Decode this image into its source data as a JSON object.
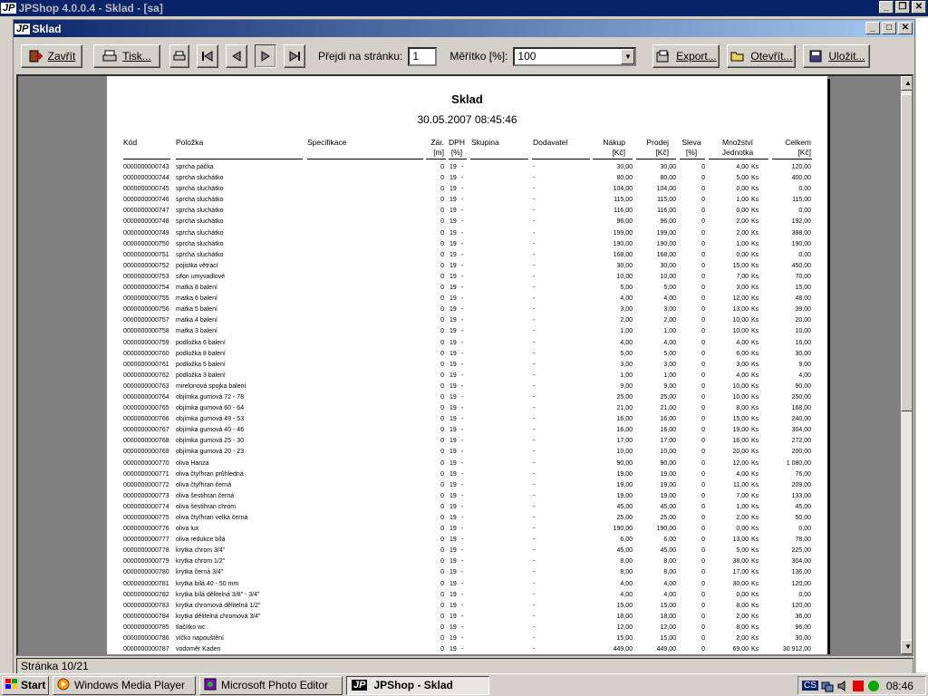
{
  "outer_window": {
    "title": "JPShop 4.0.0.4 - Sklad - [sa]",
    "logo": "JP"
  },
  "inner_window": {
    "title": "Sklad",
    "logo": "JP"
  },
  "toolbar": {
    "close_label": "Zavřít",
    "print_label": "Tisk...",
    "goto_label": "Přejdi na stránku:",
    "goto_value": "1",
    "scale_label": "Měřítko [%]:",
    "scale_value": "100",
    "export_label": "Export...",
    "open_label": "Otevřít...",
    "save_label": "Uložit..."
  },
  "report": {
    "title": "Sklad",
    "datetime": "30.05.2007 08:45:46",
    "columns": {
      "kod": "Kód",
      "polozka": "Položka",
      "specifikace": "Specifikace",
      "zar1": "Zár.",
      "zar2": "[m]",
      "dph1": "DPH",
      "dph2": "[%]",
      "skupina": "Skupina",
      "dodavatel": "Dodavatel",
      "nakup1": "Nákup",
      "nakup2": "[Kč]",
      "prodej1": "Prodej",
      "prodej2": "[Kč]",
      "sleva1": "Sleva",
      "sleva2": "[%]",
      "mnozstvi1": "Množství",
      "mnozstvi2": "Jednotka",
      "celkem1": "Celkem",
      "celkem2": "[Kč]"
    },
    "rows": [
      [
        "0000000000743",
        "sprcha páčka",
        "0",
        "19",
        "-",
        "-",
        "30,00",
        "30,00",
        "0",
        "4,00",
        "Ks",
        "120,00"
      ],
      [
        "0000000000744",
        "sprcha sluchátko",
        "0",
        "19",
        "-",
        "-",
        "80,00",
        "80,00",
        "0",
        "5,00",
        "Ks",
        "400,00"
      ],
      [
        "0000000000745",
        "sprcha sluchátko",
        "0",
        "19",
        "-",
        "-",
        "104,00",
        "104,00",
        "0",
        "0,00",
        "Ks",
        "0,00"
      ],
      [
        "0000000000746",
        "sprcha sluchátko",
        "0",
        "19",
        "-",
        "-",
        "115,00",
        "115,00",
        "0",
        "1,00",
        "Ks",
        "115,00"
      ],
      [
        "0000000000747",
        "sprcha sluchátko",
        "0",
        "19",
        "-",
        "-",
        "116,00",
        "116,00",
        "0",
        "0,00",
        "Ks",
        "0,00"
      ],
      [
        "0000000000748",
        "sprcha sluchátko",
        "0",
        "19",
        "-",
        "-",
        "96,00",
        "96,00",
        "0",
        "2,00",
        "Ks",
        "192,00"
      ],
      [
        "0000000000749",
        "sprcha sluchátko",
        "0",
        "19",
        "-",
        "-",
        "199,00",
        "199,00",
        "0",
        "2,00",
        "Ks",
        "398,00"
      ],
      [
        "0000000000750",
        "sprcha sluchátko",
        "0",
        "19",
        "-",
        "-",
        "190,00",
        "190,00",
        "0",
        "1,00",
        "Ks",
        "190,00"
      ],
      [
        "0000000000751",
        "sprcha sluchátko",
        "0",
        "19",
        "-",
        "-",
        "168,00",
        "168,00",
        "0",
        "0,00",
        "Ks",
        "0,00"
      ],
      [
        "0000000000752",
        "pojistka větrací",
        "0",
        "19",
        "-",
        "-",
        "30,00",
        "30,00",
        "0",
        "15,00",
        "Ks",
        "450,00"
      ],
      [
        "0000000000753",
        "sifon umyvadlové",
        "0",
        "19",
        "-",
        "-",
        "10,00",
        "10,00",
        "0",
        "7,00",
        "Ks",
        "70,00"
      ],
      [
        "0000000000754",
        "matka 8 balení",
        "0",
        "19",
        "-",
        "-",
        "5,00",
        "5,00",
        "0",
        "3,00",
        "Ks",
        "15,00"
      ],
      [
        "0000000000755",
        "matka 6 balení",
        "0",
        "19",
        "-",
        "-",
        "4,00",
        "4,00",
        "0",
        "12,00",
        "Ks",
        "48,00"
      ],
      [
        "0000000000756",
        "matka 5 balení",
        "0",
        "19",
        "-",
        "-",
        "3,00",
        "3,00",
        "0",
        "13,00",
        "Ks",
        "39,00"
      ],
      [
        "0000000000757",
        "matka 4 balení",
        "0",
        "19",
        "-",
        "-",
        "2,00",
        "2,00",
        "0",
        "10,00",
        "Ks",
        "20,00"
      ],
      [
        "0000000000758",
        "matka 3 balení",
        "0",
        "19",
        "-",
        "-",
        "1,00",
        "1,00",
        "0",
        "10,00",
        "Ks",
        "10,00"
      ],
      [
        "0000000000759",
        "podložka 6 balení",
        "0",
        "19",
        "-",
        "-",
        "4,00",
        "4,00",
        "0",
        "4,00",
        "Ks",
        "16,00"
      ],
      [
        "0000000000760",
        "podložka 8 balení",
        "0",
        "19",
        "-",
        "-",
        "5,00",
        "5,00",
        "0",
        "6,00",
        "Ks",
        "30,00"
      ],
      [
        "0000000000761",
        "podložka 5 balení",
        "0",
        "19",
        "-",
        "-",
        "3,00",
        "3,00",
        "0",
        "3,00",
        "Ks",
        "9,00"
      ],
      [
        "0000000000762",
        "podložka 3 balení",
        "0",
        "19",
        "-",
        "-",
        "1,00",
        "1,00",
        "0",
        "4,00",
        "Ks",
        "4,00"
      ],
      [
        "0000000000763",
        "mirelonová spojka balení",
        "0",
        "19",
        "-",
        "-",
        "9,00",
        "9,00",
        "0",
        "10,00",
        "Ks",
        "90,00"
      ],
      [
        "0000000000764",
        "objímka gumová 72 - 78",
        "0",
        "19",
        "-",
        "-",
        "25,00",
        "25,00",
        "0",
        "10,00",
        "Ks",
        "250,00"
      ],
      [
        "0000000000765",
        "objímka gumová 60 - 64",
        "0",
        "19",
        "-",
        "-",
        "21,00",
        "21,00",
        "0",
        "8,00",
        "Ks",
        "168,00"
      ],
      [
        "0000000000766",
        "objímka gumová 49 - 53",
        "0",
        "19",
        "-",
        "-",
        "16,00",
        "16,00",
        "0",
        "15,00",
        "Ks",
        "240,00"
      ],
      [
        "0000000000767",
        "objímka gumová 40 - 46",
        "0",
        "19",
        "-",
        "-",
        "16,00",
        "16,00",
        "0",
        "19,00",
        "Ks",
        "304,00"
      ],
      [
        "0000000000768",
        "objímka gumová 25 - 30",
        "0",
        "19",
        "-",
        "-",
        "17,00",
        "17,00",
        "0",
        "16,00",
        "Ks",
        "272,00"
      ],
      [
        "0000000000769",
        "objímka gumová 20 - 23",
        "0",
        "19",
        "-",
        "-",
        "10,00",
        "10,00",
        "0",
        "20,00",
        "Ks",
        "200,00"
      ],
      [
        "0000000000770",
        "oliva Hanza",
        "0",
        "19",
        "-",
        "-",
        "90,00",
        "90,00",
        "0",
        "12,00",
        "Ks",
        "1 080,00"
      ],
      [
        "0000000000771",
        "oliva čtyřhran průhledná",
        "0",
        "19",
        "-",
        "-",
        "19,00",
        "19,00",
        "0",
        "4,00",
        "Ks",
        "76,00"
      ],
      [
        "0000000000772",
        "oliva čtyřhran černá",
        "0",
        "19",
        "-",
        "-",
        "19,00",
        "19,00",
        "0",
        "11,00",
        "Ks",
        "209,00"
      ],
      [
        "0000000000773",
        "oliva šestihran černá",
        "0",
        "19",
        "-",
        "-",
        "19,00",
        "19,00",
        "0",
        "7,00",
        "Ks",
        "133,00"
      ],
      [
        "0000000000774",
        "oliva šestihran chrom",
        "0",
        "19",
        "-",
        "-",
        "45,00",
        "45,00",
        "0",
        "1,00",
        "Ks",
        "45,00"
      ],
      [
        "0000000000775",
        "oliva čtyřhran velká černá",
        "0",
        "19",
        "-",
        "-",
        "25,00",
        "25,00",
        "0",
        "2,00",
        "Ks",
        "50,00"
      ],
      [
        "0000000000776",
        "oliva lux",
        "0",
        "19",
        "-",
        "-",
        "190,00",
        "190,00",
        "0",
        "0,00",
        "Ks",
        "0,00"
      ],
      [
        "0000000000777",
        "oliva redukce bílá",
        "0",
        "19",
        "-",
        "-",
        "6,00",
        "6,00",
        "0",
        "13,00",
        "Ks",
        "78,00"
      ],
      [
        "0000000000778",
        "krytka chrom 3/4\"",
        "0",
        "19",
        "-",
        "-",
        "45,00",
        "45,00",
        "0",
        "5,00",
        "Ks",
        "225,00"
      ],
      [
        "0000000000779",
        "krytka chrom 1/2\"",
        "0",
        "19",
        "-",
        "-",
        "8,00",
        "8,00",
        "0",
        "38,00",
        "Ks",
        "304,00"
      ],
      [
        "0000000000780",
        "krytka černá 3/4\"",
        "0",
        "19",
        "-",
        "-",
        "8,00",
        "8,00",
        "0",
        "17,00",
        "Ks",
        "136,00"
      ],
      [
        "0000000000781",
        "krytka bílá 40 - 50 mm",
        "0",
        "19",
        "-",
        "-",
        "4,00",
        "4,00",
        "0",
        "30,00",
        "Ks",
        "120,00"
      ],
      [
        "0000000000782",
        "krytka bílá dělitelná 3/8\" - 3/4\"",
        "0",
        "19",
        "-",
        "-",
        "4,00",
        "4,00",
        "0",
        "0,00",
        "Ks",
        "0,00"
      ],
      [
        "0000000000783",
        "krytka chromová dělitelná 1/2\"",
        "0",
        "19",
        "-",
        "-",
        "15,00",
        "15,00",
        "0",
        "8,00",
        "Ks",
        "120,00"
      ],
      [
        "0000000000784",
        "krytka dělitelná chromová 3/4\"",
        "0",
        "19",
        "-",
        "-",
        "18,00",
        "18,00",
        "0",
        "2,00",
        "Ks",
        "36,00"
      ],
      [
        "0000000000785",
        "tlačítko wc",
        "0",
        "19",
        "-",
        "-",
        "12,00",
        "12,00",
        "0",
        "8,00",
        "Ks",
        "96,00"
      ],
      [
        "0000000000786",
        "víčko napouštění",
        "0",
        "19",
        "-",
        "-",
        "15,00",
        "15,00",
        "0",
        "2,00",
        "Ks",
        "30,00"
      ],
      [
        "0000000000787",
        "vodoměr Kaden",
        "0",
        "19",
        "-",
        "-",
        "449,00",
        "449,00",
        "0",
        "69,00",
        "Ks",
        "30 912,00"
      ]
    ]
  },
  "status": {
    "text": "Stránka 10/21"
  },
  "taskbar": {
    "start": "Start",
    "tasks": [
      "Windows Media Player",
      "Microsoft Photo Editor",
      "JPShop - Sklad"
    ],
    "clock": "08:46",
    "tray_lang": "CS"
  }
}
